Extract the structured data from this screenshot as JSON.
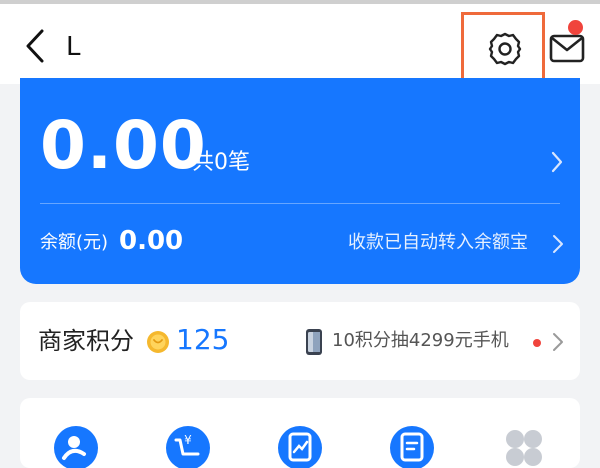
{
  "header": {
    "title": "L",
    "back_icon": "chevron-left-icon",
    "settings_icon": "gear-icon",
    "mail_icon": "mail-icon",
    "mail_badge_color": "#f0443c",
    "highlight_color": "#ef6a3b"
  },
  "balance_card": {
    "amount": "0.00",
    "count_text": "共0笔",
    "balance_label": "余额(元)",
    "balance_value": "0.00",
    "auto_transfer_text": "收款已自动转入余额宝",
    "background_color": "#1677ff"
  },
  "points": {
    "label": "商家积分",
    "value": "125",
    "promo_text": "10积分抽4299元手机",
    "coin_icon": "coin-icon",
    "phone_icon": "phone-icon"
  },
  "menu": {
    "icons": [
      "person-icon",
      "cart-icon",
      "chart-icon",
      "document-icon",
      "more-grid-icon"
    ]
  }
}
